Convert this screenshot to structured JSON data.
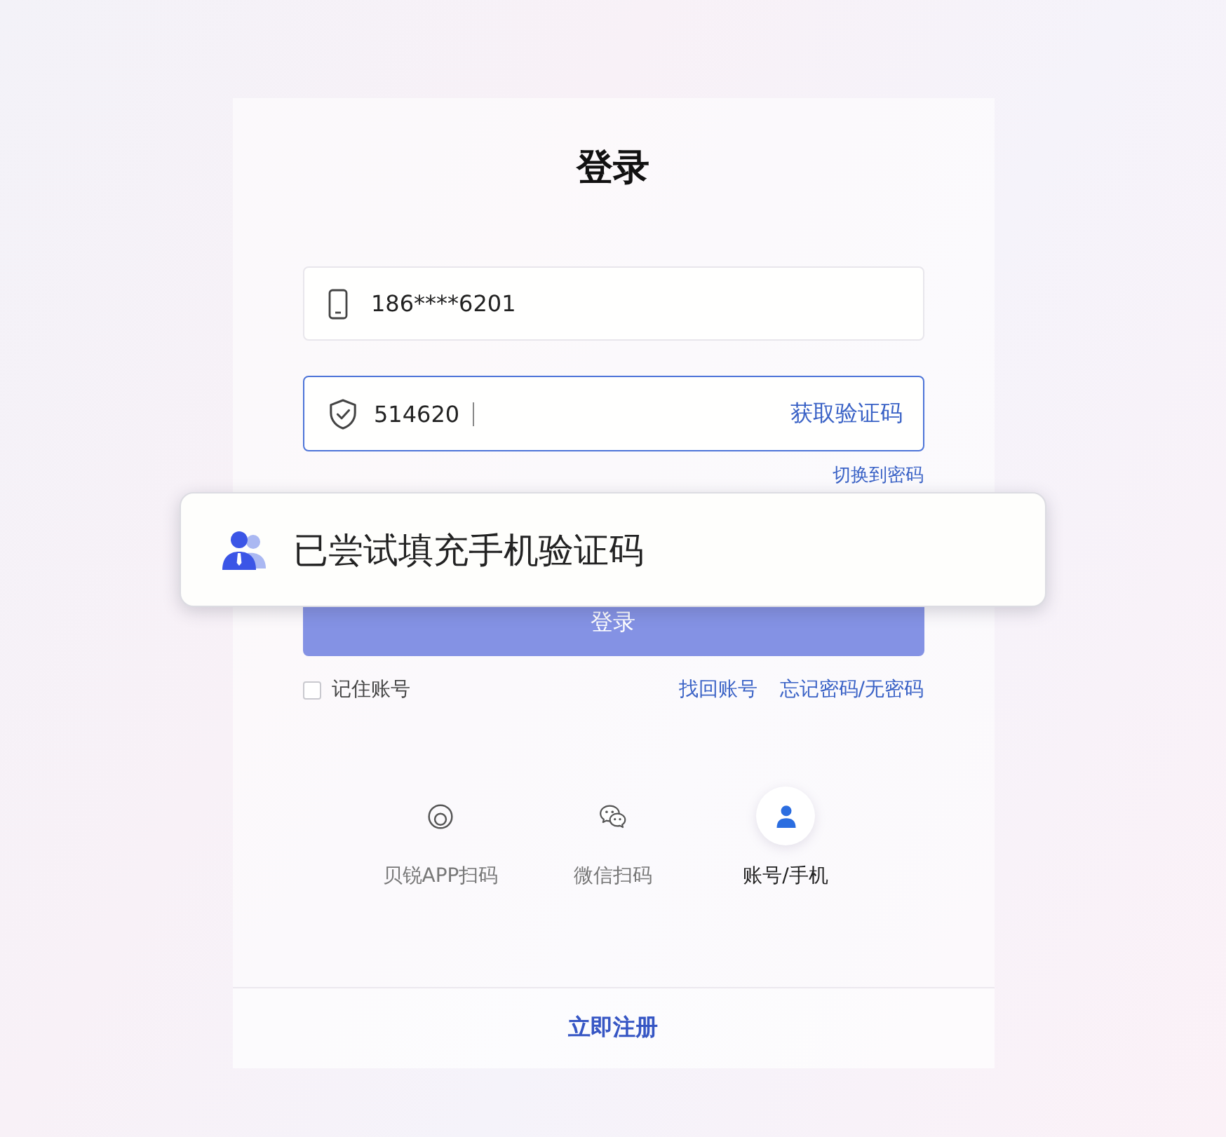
{
  "title": "登录",
  "phone_field": {
    "value": "186****6201"
  },
  "code_field": {
    "value": "514620",
    "focused": true,
    "action": "获取验证码"
  },
  "switch_link": "切换到密码",
  "toast": {
    "text": "已尝试填充手机验证码"
  },
  "login_button": {
    "label": "登录",
    "disabled": true
  },
  "remember": {
    "label": "记住账号",
    "checked": false
  },
  "links": [
    "找回账号",
    "忘记密码/无密码"
  ],
  "login_methods": [
    {
      "label": "贝锐APP扫码",
      "kind": "app",
      "selected": false
    },
    {
      "label": "微信扫码",
      "kind": "wechat",
      "selected": false
    },
    {
      "label": "账号/手机",
      "kind": "account",
      "selected": true
    }
  ],
  "register_link": "立即注册"
}
